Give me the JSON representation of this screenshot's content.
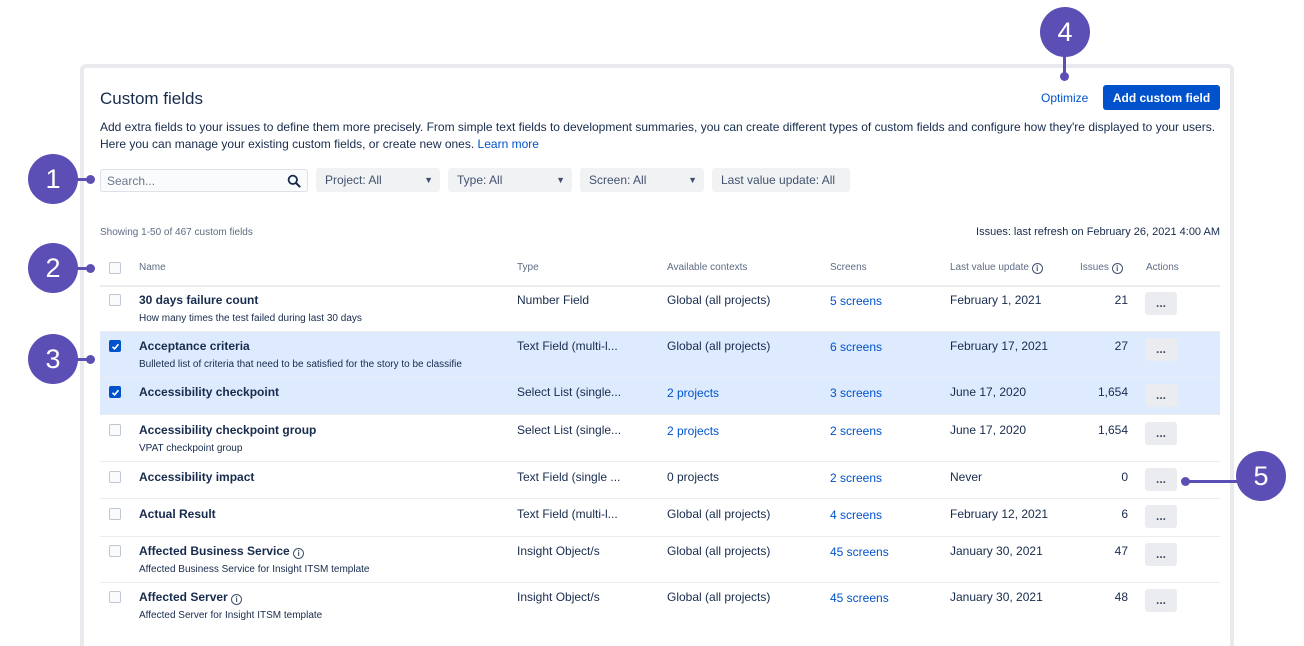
{
  "header": {
    "title": "Custom fields",
    "optimize_label": "Optimize",
    "add_button_label": "Add custom field",
    "description": "Add extra fields to your issues to define them more precisely. From simple text fields to development summaries, you can create different types of custom fields and configure how they're displayed to your users. Here you can manage your existing custom fields, or create new ones.",
    "learn_more": "Learn more"
  },
  "filters": {
    "search_placeholder": "Search...",
    "project": "Project: All",
    "type": "Type: All",
    "screen": "Screen: All",
    "last_value_update": "Last value update: All"
  },
  "summary": {
    "showing": "Showing 1-50 of 467 custom fields",
    "refresh": "Issues: last refresh on February 26, 2021 4:00 AM"
  },
  "columns": {
    "name": "Name",
    "type": "Type",
    "contexts": "Available contexts",
    "screens": "Screens",
    "last_value_update": "Last value update",
    "issues": "Issues",
    "actions": "Actions"
  },
  "rows": [
    {
      "name": "30 days failure count",
      "desc": "How many times the test failed during last 30 days",
      "type": "Number Field",
      "contexts": "Global (all projects)",
      "screens": "5 screens",
      "last_update": "February 1, 2021",
      "issues": "21",
      "checked": false,
      "selected": false,
      "ctx_link": false,
      "info": false
    },
    {
      "name": "Acceptance criteria",
      "desc": "Bulleted list of criteria that need to be satisfied for the story to be classifie",
      "type": "Text Field (multi-l...",
      "contexts": "Global (all projects)",
      "screens": "6 screens",
      "last_update": "February 17, 2021",
      "issues": "27",
      "checked": true,
      "selected": true,
      "ctx_link": false,
      "info": false
    },
    {
      "name": "Accessibility checkpoint",
      "desc": "",
      "type": "Select List (single...",
      "contexts": "2 projects",
      "screens": "3 screens",
      "last_update": "June 17, 2020",
      "issues": "1,654",
      "checked": true,
      "selected": true,
      "ctx_link": true,
      "info": false
    },
    {
      "name": "Accessibility checkpoint group",
      "desc": "VPAT checkpoint group",
      "type": "Select List (single...",
      "contexts": "2 projects",
      "screens": "2 screens",
      "last_update": "June 17, 2020",
      "issues": "1,654",
      "checked": false,
      "selected": false,
      "ctx_link": true,
      "info": false
    },
    {
      "name": "Accessibility impact",
      "desc": "",
      "type": "Text Field (single ...",
      "contexts": "0 projects",
      "screens": "2 screens",
      "last_update": "Never",
      "issues": "0",
      "checked": false,
      "selected": false,
      "ctx_link": false,
      "info": false
    },
    {
      "name": "Actual Result",
      "desc": "",
      "type": "Text Field (multi-l...",
      "contexts": "Global (all projects)",
      "screens": "4 screens",
      "last_update": "February 12, 2021",
      "issues": "6",
      "checked": false,
      "selected": false,
      "ctx_link": false,
      "info": false
    },
    {
      "name": "Affected Business Service",
      "desc": "Affected Business Service for Insight ITSM template",
      "type": "Insight Object/s",
      "contexts": "Global (all projects)",
      "screens": "45 screens",
      "last_update": "January 30, 2021",
      "issues": "47",
      "checked": false,
      "selected": false,
      "ctx_link": false,
      "info": true
    },
    {
      "name": "Affected Server",
      "desc": "Affected Server for Insight ITSM template",
      "type": "Insight Object/s",
      "contexts": "Global (all projects)",
      "screens": "45 screens",
      "last_update": "January 30, 2021",
      "issues": "48",
      "checked": false,
      "selected": false,
      "ctx_link": false,
      "info": true
    }
  ],
  "actions_label": "...",
  "info_glyph": "i",
  "callouts": [
    "1",
    "2",
    "3",
    "4",
    "5"
  ],
  "colors": {
    "accent": "#0052cc",
    "callout": "#5b4fb5",
    "selected_row": "#deebff"
  }
}
